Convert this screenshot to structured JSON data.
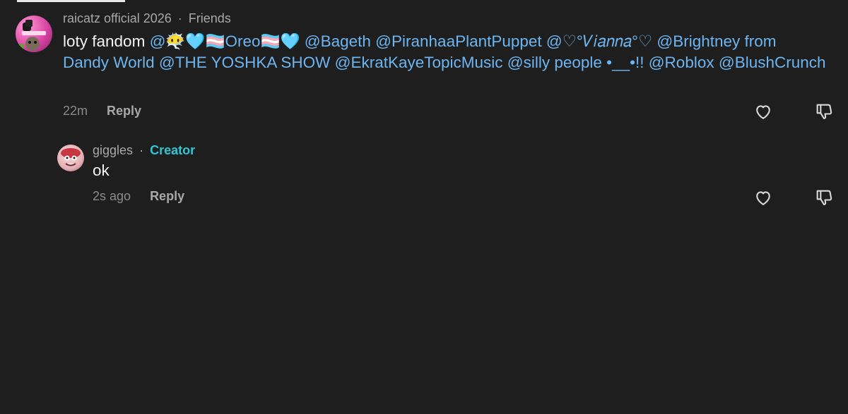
{
  "main_comment": {
    "author": "raicatz official 2026",
    "separator": "·",
    "relation": "Friends",
    "text_prefix": "loty fandom ",
    "mentions_line": "@😶‍🌫️🩵🏳️‍⚧️Oreo🏳️‍⚧️🩵 @Bageth @PiranhaaPlantPuppet @♡°𝑉𝑖𝑎𝑛𝑛𝑎°♡ @Brightney from Dandy World @THE YOSHKA SHOW @EkratKayeTopicMusic @silly people •__•!! @Roblox @BlushCrunch",
    "timestamp": "22m",
    "reply_label": "Reply"
  },
  "reply_comment": {
    "author": "giggles",
    "separator": "·",
    "badge": "Creator",
    "text": "ok",
    "timestamp": "2s ago",
    "reply_label": "Reply"
  },
  "icons": {
    "like": "heart-outline-icon",
    "dislike": "thumbs-down-outline-icon"
  },
  "colors": {
    "background": "#1e1e1e",
    "mention": "#6cb5f0",
    "creator_badge": "#30c6d6",
    "muted_text": "#a8a8a8"
  }
}
